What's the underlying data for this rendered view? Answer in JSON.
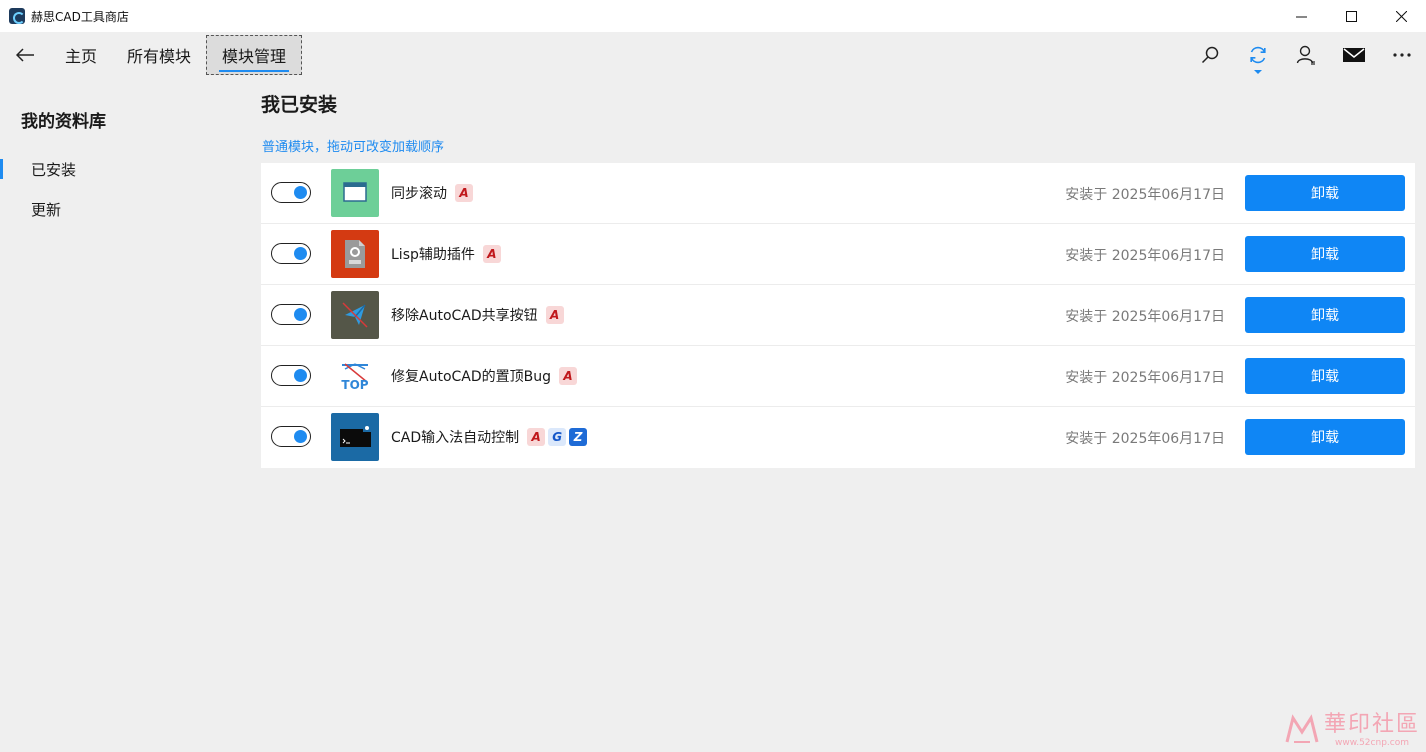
{
  "window": {
    "title": "赫思CAD工具商店",
    "controls": [
      "minimize",
      "maximize",
      "close"
    ]
  },
  "nav": {
    "tabs": [
      {
        "label": "主页"
      },
      {
        "label": "所有模块"
      },
      {
        "label": "模块管理",
        "active": true
      }
    ],
    "right_icons": [
      "search-icon",
      "sync-icon",
      "account-icon",
      "mail-icon",
      "more-icon"
    ]
  },
  "sidebar": {
    "title": "我的资料库",
    "items": [
      {
        "label": "已安装",
        "active": true
      },
      {
        "label": "更新"
      }
    ]
  },
  "main": {
    "title": "我已安装",
    "subtitle": "普通模块，拖动可改变加载顺序",
    "modules": [
      {
        "name": "同步滚动",
        "date": "安装于 2025年06月17日",
        "button": "卸载",
        "enabled": true,
        "icon": "window-sync-icon",
        "icon_color": "#6dcf98",
        "badges": [
          "A"
        ]
      },
      {
        "name": "Lisp辅助插件",
        "date": "安装于 2025年06月17日",
        "button": "卸载",
        "enabled": true,
        "icon": "lisp-file-icon",
        "icon_color": "#d43a12",
        "badges": [
          "A"
        ]
      },
      {
        "name": "移除AutoCAD共享按钮",
        "date": "安装于 2025年06月17日",
        "button": "卸载",
        "enabled": true,
        "icon": "share-remove-icon",
        "icon_color": "#545648",
        "badges": [
          "A"
        ]
      },
      {
        "name": "修复AutoCAD的置顶Bug",
        "date": "安装于 2025年06月17日",
        "button": "卸载",
        "enabled": true,
        "icon": "top-fix-icon",
        "icon_color": "#ffffff",
        "icon_text": "TOP",
        "badges": [
          "A"
        ]
      },
      {
        "name": "CAD输入法自动控制",
        "date": "安装于 2025年06月17日",
        "button": "卸载",
        "enabled": true,
        "icon": "console-ime-icon",
        "icon_color": "#1b6aa5",
        "badges": [
          "A",
          "G",
          "Z"
        ]
      }
    ]
  },
  "watermark": {
    "text": "華印社區",
    "url": "www.52cnp.com"
  },
  "colors": {
    "accent": "#1e8bf0",
    "button": "#0f86f5",
    "background": "#efefef"
  }
}
